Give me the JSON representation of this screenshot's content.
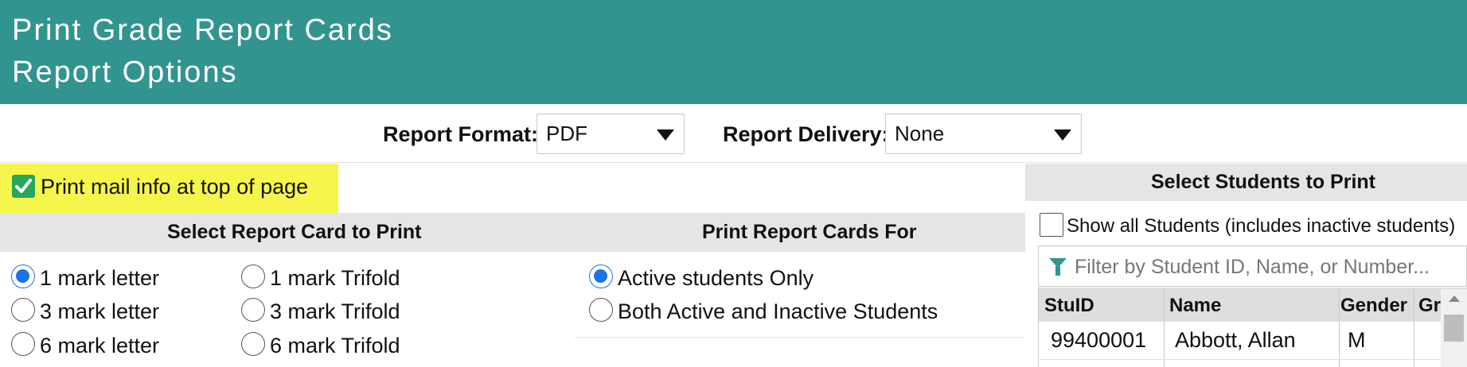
{
  "header": {
    "title": "Print Grade Report Cards",
    "subtitle": "Report Options"
  },
  "format": {
    "label": "Report Format:",
    "value": "PDF"
  },
  "delivery": {
    "label": "Report Delivery:",
    "value": "None"
  },
  "mail_info": {
    "label": "Print mail info at top of page",
    "checked": true,
    "highlight": "#f6f54b"
  },
  "report_card": {
    "heading": "Select Report Card to Print",
    "options": [
      "1 mark letter",
      "1 mark Trifold",
      "3 mark letter",
      "3 mark Trifold",
      "6 mark letter",
      "6 mark Trifold"
    ],
    "selected": "1 mark letter"
  },
  "print_for": {
    "heading": "Print Report Cards For",
    "options": [
      "Active students Only",
      "Both Active and Inactive Students"
    ],
    "selected": "Active students Only"
  },
  "students": {
    "heading": "Select Students to Print",
    "show_all_label": "Show all Students (includes inactive students)",
    "filter_placeholder": "Filter by Student ID, Name, or Number...",
    "columns": [
      "StuID",
      "Name",
      "Gender",
      "Gr"
    ],
    "rows": [
      {
        "stuid": "99400001",
        "name": "Abbott, Allan",
        "gender": "M"
      }
    ]
  },
  "colors": {
    "header": "#31948f",
    "accent": "#1a73e8",
    "check": "#25a85a",
    "panel": "#e4e5e4"
  },
  "icons": [
    "caret-down-icon",
    "checkmark-icon",
    "filter-icon",
    "scroll-up-icon"
  ]
}
